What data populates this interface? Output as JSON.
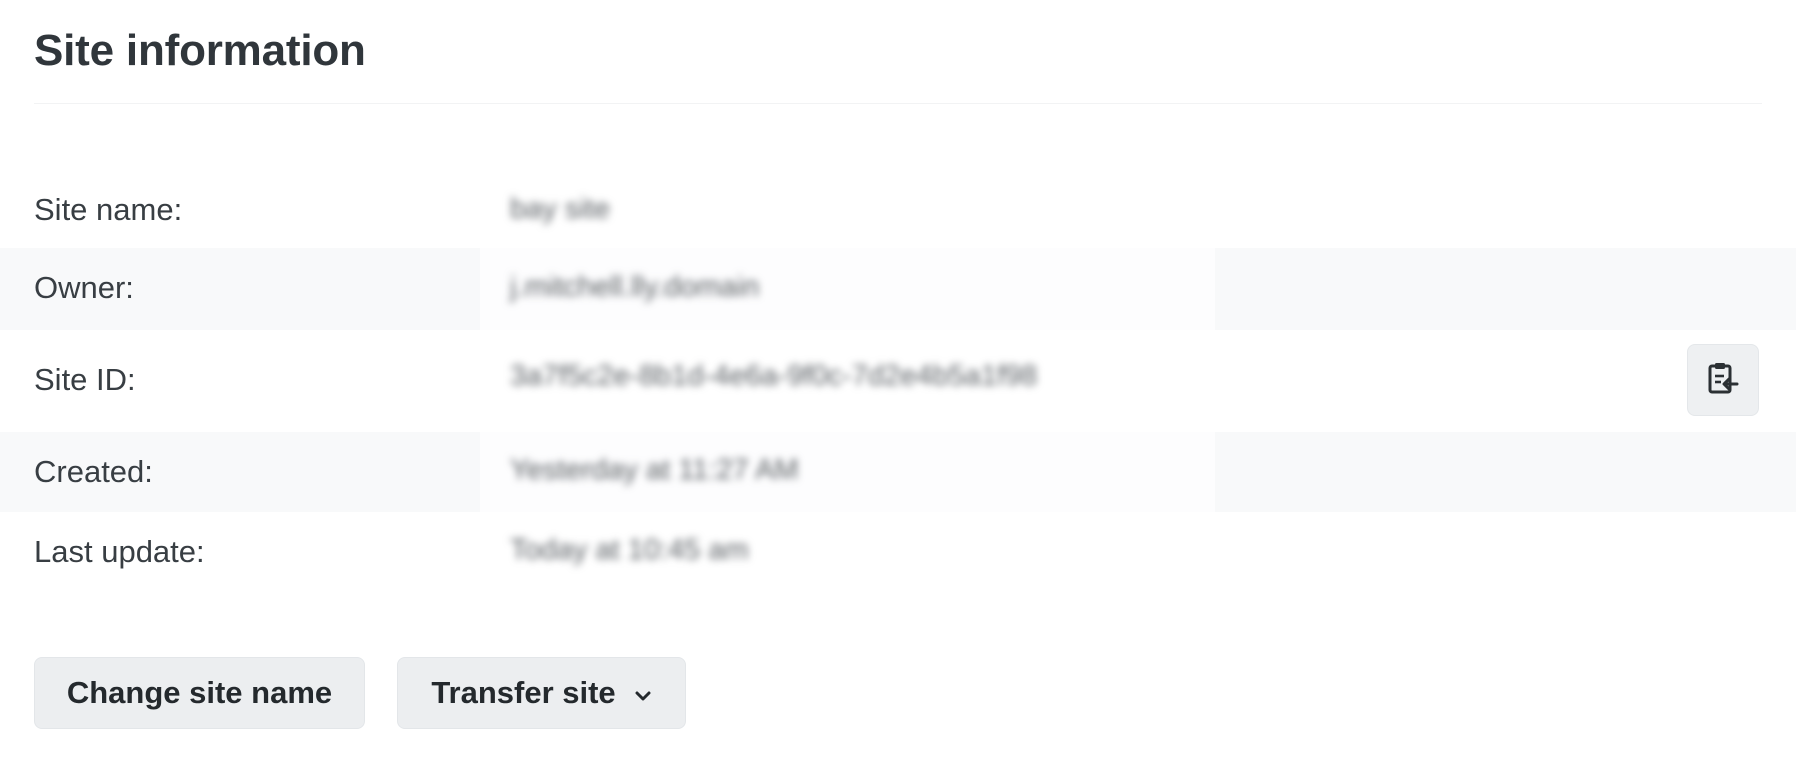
{
  "page": {
    "title": "Site information"
  },
  "fields": {
    "site_name": {
      "label": "Site name:",
      "value": "bay site"
    },
    "owner": {
      "label": "Owner:",
      "value": "j.mitchell.lly.domain"
    },
    "site_id": {
      "label": "Site ID:",
      "value": "3a7f5c2e-8b1d-4e6a-9f0c-7d2e4b5a1f98"
    },
    "created": {
      "label": "Created:",
      "value": "Yesterday at 11:27 AM"
    },
    "last_update": {
      "label": "Last update:",
      "value": "Today at 10:45 am"
    }
  },
  "actions": {
    "change_name_label": "Change site name",
    "transfer_label": "Transfer site"
  },
  "icons": {
    "copy": "clipboard-copy-icon",
    "dropdown": "chevron-down-icon"
  },
  "colors": {
    "button_bg": "#eceef0",
    "row_shade": "#f8f9fa",
    "text": "#333a3f"
  }
}
